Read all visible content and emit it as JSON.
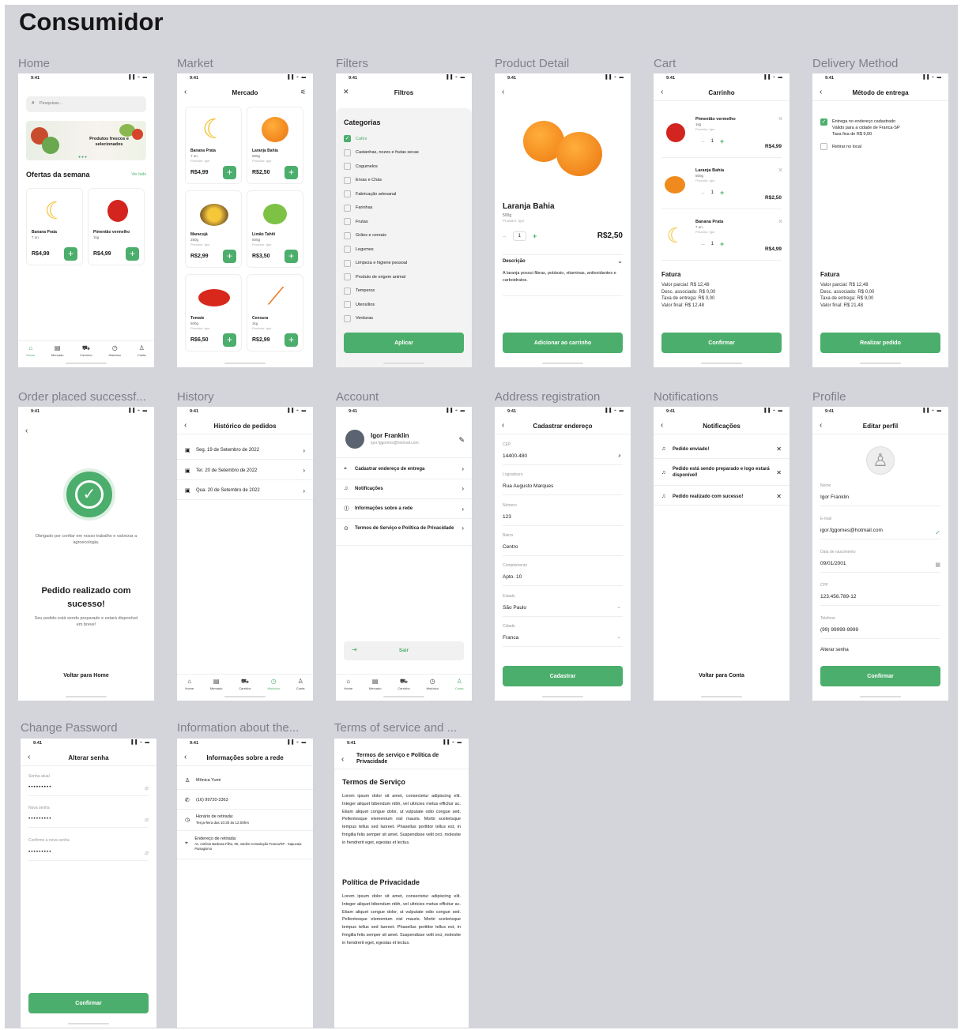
{
  "page": {
    "title": "Consumidor"
  },
  "status": {
    "time": "9:41",
    "icons": "▐▐ ⌁ ▬"
  },
  "frames": {
    "home": "Home",
    "market": "Market",
    "filters": "Filters",
    "detail": "Product Detail",
    "cart": "Cart",
    "delivery": "Delivery Method",
    "ordered": "Order placed successf...",
    "history": "History",
    "account": "Account",
    "address": "Address registration",
    "notifications": "Notifications",
    "profile": "Profile",
    "password": "Change Password",
    "info": "Information about the...",
    "terms": "Terms of service and ..."
  },
  "tabs": {
    "home": "Home",
    "mercado": "Mercado",
    "carrinho": "Carrinho",
    "historico": "Histórico",
    "conta": "Conta"
  },
  "home": {
    "search_placeholder": "Pesquisar...",
    "banner": "Produtos frescos e selecionados",
    "section": "Ofertas da semana",
    "see_all": "Ver tudo",
    "p1_name": "Banana Prata",
    "p1_unit": "7 un.",
    "p1_price": "R$4,99",
    "p2_name": "Pimentão vermelho",
    "p2_unit": "1kg",
    "p2_price": "R$4,99"
  },
  "market": {
    "title": "Mercado",
    "producer": "Produtor: Igor",
    "products": [
      {
        "name": "Banana Prata",
        "unit": "7 un.",
        "price": "R$4,99"
      },
      {
        "name": "Laranja Bahia",
        "unit": "500g",
        "price": "R$2,50"
      },
      {
        "name": "Maracujá",
        "unit": "250g",
        "price": "R$2,99"
      },
      {
        "name": "Limão Tahiti",
        "unit": "500g",
        "price": "R$3,50"
      },
      {
        "name": "Tomate",
        "unit": "500g",
        "price": "R$6,50"
      },
      {
        "name": "Cenoura",
        "unit": "1kg",
        "price": "R$2,99"
      }
    ]
  },
  "filters": {
    "title": "Filtros",
    "heading": "Categorias",
    "items": [
      "Cafés",
      "Castanhas, nozes e frutas secas",
      "Cogumelos",
      "Ervas e Chás",
      "Fabricação artesanal",
      "Farinhas",
      "Frutas",
      "Grãos e cereais",
      "Legumes",
      "Limpeza e higiene pessoal",
      "Produto de origem animal",
      "Temperos",
      "Utensílios",
      "Verduras"
    ],
    "apply": "Aplicar"
  },
  "detail": {
    "name": "Laranja Bahia",
    "unit": "500g",
    "producer": "Produtor: Igor",
    "qty": "1",
    "price": "R$2,50",
    "desc_label": "Descrição",
    "desc": "A laranja possui fibras, potássio, vitaminas, antioxidantes e carboidratos.",
    "add": "Adicionar ao carrinho"
  },
  "cart": {
    "title": "Carrinho",
    "items": [
      {
        "name": "Pimentão vermelho",
        "unit": "1kg",
        "qty": "1",
        "price": "R$4,99"
      },
      {
        "name": "Laranja Bahia",
        "unit": "500g",
        "qty": "1",
        "price": "R$2,50"
      },
      {
        "name": "Banana Prata",
        "unit": "7 un.",
        "qty": "1",
        "price": "R$4,99"
      }
    ],
    "invoice": "Fatura",
    "l1": "Valor parcial: R$ 12,48",
    "l2": "Desc. associado: R$ 0,00",
    "l3": "Taxa de entrega: R$ 0,00",
    "l4": "Valor final: R$ 12,48",
    "confirm": "Confirmar"
  },
  "delivery": {
    "title": "Método de entrega",
    "opt1a": "Entrega no endereço cadastrado",
    "opt1b": "Válido para a cidade de Franca-SP",
    "opt1c": "Taxa fixa de R$ 9,00",
    "opt2": "Retirar no local",
    "invoice": "Fatura",
    "l1": "Valor parcial: R$ 12,48",
    "l2": "Desc. associado: R$ 0,00",
    "l3": "Taxa de entrega: R$ 9,00",
    "l4": "Valor final: R$ 21,48",
    "submit": "Realizar pedido"
  },
  "ordered": {
    "thanks": "Obrigado por confiar em nosso trabalho e valorizar a agroecologia.",
    "headline": "Pedido realizado com sucesso!",
    "sub": "Seu pedido está sendo preparado e estará disponível em breve!",
    "back": "Voltar para Home"
  },
  "history": {
    "title": "Histórico de pedidos",
    "items": [
      "Seg. 19 de Setembro de 2022",
      "Ter. 20 de Setembro de 2022",
      "Qua. 20 de Setembro de 2022"
    ]
  },
  "account": {
    "name": "Igor Franklin",
    "email": "igor.fggomes@hotmail.com",
    "items": [
      "Cadastrar endereço de entrega",
      "Notificações",
      "Informações sobre a rede",
      "Termos de Serviço e Política de Privacidade"
    ],
    "logout": "Sair"
  },
  "address": {
    "title": "Cadastrar endereço",
    "fields": [
      {
        "label": "CEP",
        "value": "14400-480"
      },
      {
        "label": "Logradouro",
        "value": "Rua Augusto Marques"
      },
      {
        "label": "Número",
        "value": "123"
      },
      {
        "label": "Bairro",
        "value": "Centro"
      },
      {
        "label": "Complemento",
        "value": "Apto. 10"
      },
      {
        "label": "Estado",
        "value": "São Paulo"
      },
      {
        "label": "Cidade",
        "value": "Franca"
      }
    ],
    "submit": "Cadastrar"
  },
  "notifications": {
    "title": "Notificações",
    "items": [
      "Pedido enviado!",
      "Pedido está sendo preparado e logo estará disponível!",
      "Pedido realizado com sucesso!"
    ],
    "back": "Voltar para Conta"
  },
  "profile": {
    "title": "Editar perfil",
    "fields": [
      {
        "label": "Nome",
        "value": "Igor Franklin"
      },
      {
        "label": "E-mail",
        "value": "igor.fggomes@hotmail.com"
      },
      {
        "label": "Data de nascimento",
        "value": "09/01/2001"
      },
      {
        "label": "CPF",
        "value": "123.456.789-12"
      },
      {
        "label": "Telefone",
        "value": "(99) 99999-9999"
      }
    ],
    "change_pw": "Alterar senha",
    "confirm": "Confirmar"
  },
  "password": {
    "title": "Alterar senha",
    "l1": "Senha atual",
    "l2": "Nova senha",
    "l3": "Confirme a nova senha",
    "mask": "•••••••••",
    "confirm": "Confirmar"
  },
  "info": {
    "title": "Informações sobre a rede",
    "name": "Mônica Yumi",
    "phone": "(16) 99720-3363",
    "hours_t": "Horário de retirada:",
    "hours": "Terça-feira das 10:30 às 12:00hrs",
    "addr_t": "Endereço de retirada:",
    "addr": "Av. Antônio Barbosa Filho, 80, Jardim Consolação Franca/SP - Sapucaia Paisagismo"
  },
  "terms": {
    "title": "Termos de serviço e Política de Privacidade",
    "h1": "Termos de Serviço",
    "h2": "Política de Privacidade",
    "lorem": "Lorem ipsum dolor sit amet, consectetur adipiscing elit. Integer aliquet bibendum nibh, vel ultricies metus efficitur ac. Etiam aliquet congue dolor, ut vulputate odio congue sed. Pellentesque elementum nisl mauris. Morbi scelerisque tempus tellus sed laoreet. Phasellus porttitor tellus est, in fringilla felis semper sit amet. Suspendisse velit orci, molestie in hendrerit eget, egestas et lectus."
  }
}
